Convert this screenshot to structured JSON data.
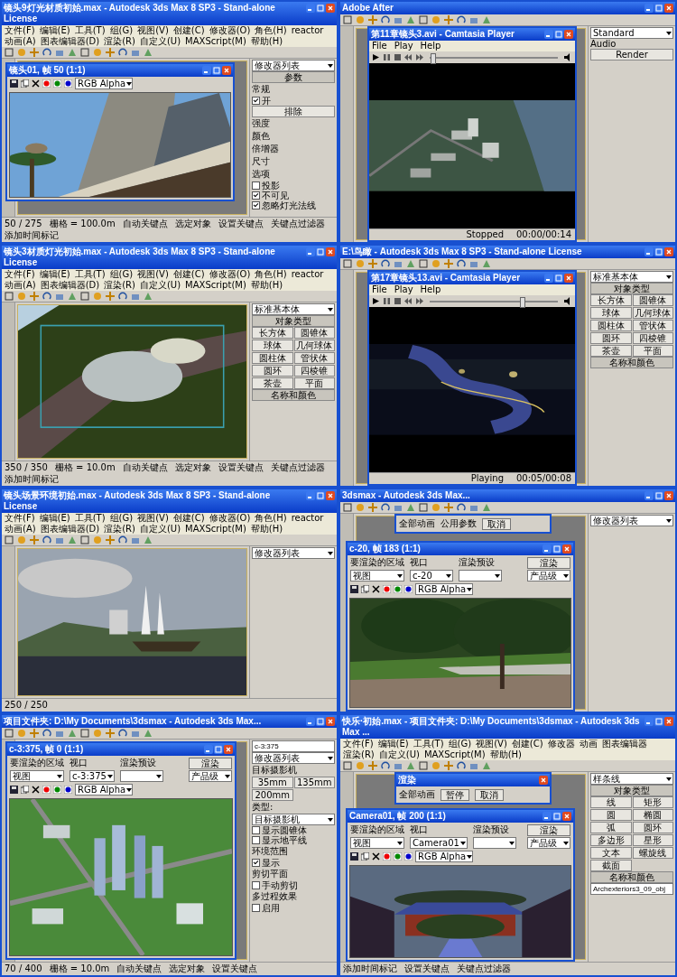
{
  "tiles": [
    {
      "title": "镜头9灯光材质初始.max - Autodesk 3ds Max 8 SP3 - Stand-alone License",
      "menu": [
        "文件(F)",
        "编辑(E)",
        "工具(T)",
        "组(G)",
        "视图(V)",
        "创建(C)",
        "修改器(O)",
        "角色(H)",
        "reactor",
        "动画(A)",
        "图表编辑器(D)",
        "渲染(R)",
        "自定义(U)",
        "MAXScript(M)",
        "帮助(H)"
      ],
      "inner": {
        "kind": "render",
        "title": "镜头01, 帧 50 (1:1)",
        "channel": "RGB Alpha"
      },
      "panel": [
        {
          "kind": "select",
          "text": "修改器列表"
        },
        {
          "kind": "header",
          "text": "参数"
        },
        {
          "kind": "label",
          "text": "常规"
        },
        {
          "kind": "check",
          "text": "开",
          "checked": true
        },
        {
          "kind": "button",
          "text": "排除"
        },
        {
          "kind": "label",
          "text": "强度"
        },
        {
          "kind": "label",
          "text": "颜色"
        },
        {
          "kind": "label",
          "text": "倍增器"
        },
        {
          "kind": "label",
          "text": "尺寸"
        },
        {
          "kind": "label",
          "text": "选项"
        },
        {
          "kind": "check",
          "text": "投影",
          "checked": false
        },
        {
          "kind": "check",
          "text": "不可见",
          "checked": true
        },
        {
          "kind": "check",
          "text": "忽略灯光法线",
          "checked": true
        }
      ],
      "status": [
        "50 / 275",
        "栅格 = 100.0m",
        "自动关键点",
        "选定对象",
        "设置关键点",
        "关键点过滤器",
        "添加时间标记"
      ]
    },
    {
      "title": "Adobe After",
      "inner": {
        "kind": "player",
        "title": "第11章镜头3.avi - Camtasia Player",
        "menu": [
          "File",
          "Play",
          "Help"
        ],
        "level": 0.02,
        "status": [
          "Stopped",
          "00:00/00:14"
        ]
      },
      "panel": [
        {
          "kind": "select",
          "text": "Standard"
        },
        {
          "kind": "label",
          "text": "Audio"
        },
        {
          "kind": "button",
          "text": "Render"
        }
      ]
    },
    {
      "title": "镜头3材质灯光初始.max - Autodesk 3ds Max 8 SP3 - Stand-alone License",
      "menu": [
        "文件(F)",
        "编辑(E)",
        "工具(T)",
        "组(G)",
        "视图(V)",
        "创建(C)",
        "修改器(O)",
        "角色(H)",
        "reactor",
        "动画(A)",
        "图表编辑器(D)",
        "渲染(R)",
        "自定义(U)",
        "MAXScript(M)",
        "帮助(H)"
      ],
      "panel": [
        {
          "kind": "select",
          "text": "标准基本体"
        },
        {
          "kind": "header",
          "text": "对象类型"
        },
        {
          "kind": "grid",
          "items": [
            "长方体",
            "圆锥体",
            "球体",
            "几何球体",
            "圆柱体",
            "管状体",
            "圆环",
            "四棱锥",
            "茶壶",
            "平面"
          ]
        },
        {
          "kind": "header",
          "text": "名称和颜色"
        }
      ],
      "status": [
        "350 / 350",
        "栅格 = 10.0m",
        "自动关键点",
        "选定对象",
        "设置关键点",
        "关键点过滤器",
        "添加时间标记"
      ]
    },
    {
      "title": "E:\\鸟瞰 - Autodesk 3ds Max 8 SP3 - Stand-alone License",
      "inner": {
        "kind": "player",
        "title": "第17章镜头13.avi - Camtasia Player",
        "menu": [
          "File",
          "Play",
          "Help"
        ],
        "level": 0.72,
        "status": [
          "Playing",
          "00:05/00:08"
        ]
      },
      "panel": [
        {
          "kind": "select",
          "text": "标准基本体"
        },
        {
          "kind": "header",
          "text": "对象类型"
        },
        {
          "kind": "grid",
          "items": [
            "长方体",
            "圆锥体",
            "球体",
            "几何球体",
            "圆柱体",
            "管状体",
            "圆环",
            "四棱锥",
            "茶壶",
            "平面"
          ]
        },
        {
          "kind": "header",
          "text": "名称和颜色"
        }
      ]
    },
    {
      "title": "镜头场景环境初始.max - Autodesk 3ds Max 8 SP3 - Stand-alone License",
      "menu": [
        "文件(F)",
        "编辑(E)",
        "工具(T)",
        "组(G)",
        "视图(V)",
        "创建(C)",
        "修改器(O)",
        "角色(H)",
        "reactor",
        "动画(A)",
        "图表编辑器(D)",
        "渲染(R)",
        "自定义(U)",
        "MAXScript(M)",
        "帮助(H)"
      ],
      "panel": [
        {
          "kind": "select",
          "text": "修改器列表"
        }
      ],
      "status": [
        "250 / 250"
      ]
    },
    {
      "title": "3dsmax - Autodesk 3ds Max...",
      "dialog": {
        "texts": [
          "全部动画",
          "公用参数"
        ],
        "buttons": [
          "取消"
        ]
      },
      "inner": {
        "kind": "render",
        "title": "c-20, 帧 183 (1:1)",
        "controls": [
          {
            "label": "要渲染的区域",
            "value": "视图"
          },
          {
            "label": "视口",
            "value": "c-20"
          },
          {
            "label": "渲染预设"
          }
        ],
        "render_button": "渲染",
        "preset": "产品级",
        "channel": "RGB Alpha"
      },
      "panel": [
        {
          "kind": "select",
          "text": "修改器列表"
        }
      ]
    },
    {
      "title": "项目文件夹: D:\\My Documents\\3dsmax - Autodesk 3ds Max...",
      "inner": {
        "kind": "render",
        "title": "c-3:375, 帧 0 (1:1)",
        "controls": [
          {
            "label": "要渲染的区域",
            "value": "视图"
          },
          {
            "label": "视口",
            "value": "c-3:375"
          },
          {
            "label": "渲染预设"
          }
        ],
        "render_button": "渲染",
        "preset": "产品级",
        "channel": "RGB Alpha"
      },
      "panel": [
        {
          "kind": "field",
          "text": "c-3:375"
        },
        {
          "kind": "select",
          "text": "修改器列表"
        },
        {
          "kind": "label",
          "text": "目标摄影机"
        },
        {
          "kind": "grid",
          "items": [
            "35mm",
            "135mm",
            "200mm"
          ]
        },
        {
          "kind": "label",
          "text": "类型:"
        },
        {
          "kind": "select",
          "text": "目标摄影机"
        },
        {
          "kind": "check",
          "text": "显示圆锥体",
          "checked": false
        },
        {
          "kind": "check",
          "text": "显示地平线",
          "checked": false
        },
        {
          "kind": "label",
          "text": "环境范围"
        },
        {
          "kind": "check",
          "text": "显示",
          "checked": true
        },
        {
          "kind": "label",
          "text": "剪切平面"
        },
        {
          "kind": "check",
          "text": "手动剪切",
          "checked": false
        },
        {
          "kind": "label",
          "text": "多过程效果"
        },
        {
          "kind": "check",
          "text": "启用",
          "checked": false
        }
      ],
      "status": [
        "70 / 400",
        "栅格 = 10.0m",
        "自动关键点",
        "选定对象",
        "设置关键点"
      ]
    },
    {
      "title": "快乐·初始.max - 项目文件夹: D:\\My Documents\\3dsmax - Autodesk 3ds Max ...",
      "menu": [
        "文件(F)",
        "编辑(E)",
        "工具(T)",
        "组(G)",
        "视图(V)",
        "创建(C)",
        "修改器",
        "动画",
        "图表编辑器",
        "渲染(R)",
        "自定义(U)",
        "MAXScript(M)",
        "帮助(H)"
      ],
      "dialog": {
        "title": "渲染",
        "texts": [
          "全部动画"
        ],
        "buttons": [
          "暂停",
          "取消"
        ]
      },
      "inner": {
        "kind": "render",
        "title": "Camera01, 帧 200 (1:1)",
        "controls": [
          {
            "label": "要渲染的区域",
            "value": "视图"
          },
          {
            "label": "视口",
            "value": "Camera01"
          },
          {
            "label": "渲染预设"
          }
        ],
        "render_button": "渲染",
        "preset": "产品级",
        "channel": "RGB Alpha"
      },
      "panel": [
        {
          "kind": "select",
          "text": "样条线"
        },
        {
          "kind": "header",
          "text": "对象类型"
        },
        {
          "kind": "grid",
          "items": [
            "线",
            "矩形",
            "圆",
            "椭圆",
            "弧",
            "圆环",
            "多边形",
            "星形",
            "文本",
            "螺旋线",
            "截面"
          ]
        },
        {
          "kind": "header",
          "text": "名称和颜色"
        },
        {
          "kind": "field",
          "text": "Archexteriors3_09_obj"
        }
      ],
      "status": [
        "添加时间标记",
        "设置关键点",
        "关键点过滤器"
      ]
    }
  ]
}
